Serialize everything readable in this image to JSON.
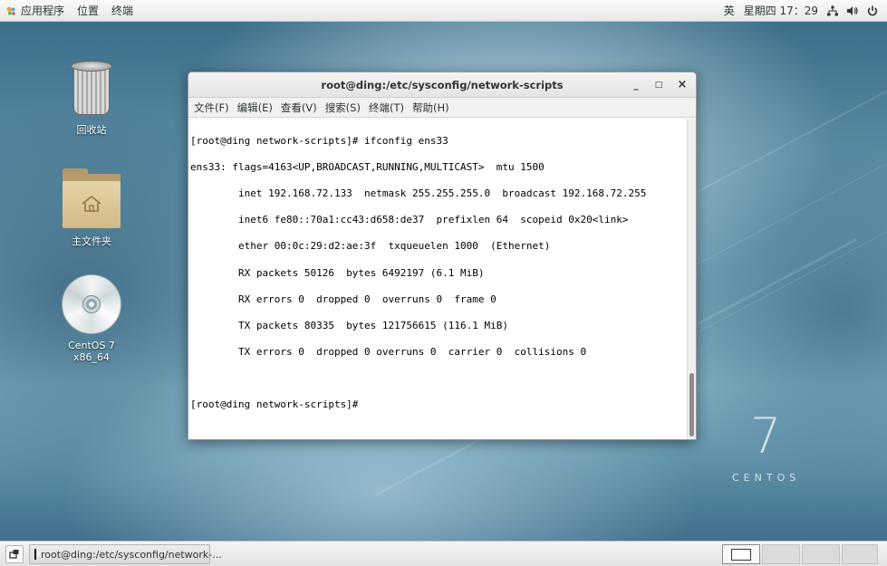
{
  "topbar": {
    "menus": [
      "应用程序",
      "位置",
      "终端"
    ],
    "input_method": "英",
    "clock": "星期四 17：29"
  },
  "desktop": {
    "icons": [
      {
        "label": "回收站",
        "icon": "trash-icon"
      },
      {
        "label": "主文件夹",
        "icon": "home-folder-icon"
      },
      {
        "label": "CentOS 7 x86_64",
        "icon": "disc-icon"
      }
    ],
    "watermark": {
      "number": "7",
      "word": "CENTOS"
    }
  },
  "terminal": {
    "title": "root@ding:/etc/sysconfig/network-scripts",
    "controls": {
      "minimize": "_",
      "maximize": "□",
      "close": "×"
    },
    "menu": [
      "文件(F)",
      "编辑(E)",
      "查看(V)",
      "搜索(S)",
      "终端(T)",
      "帮助(H)"
    ],
    "lines": [
      "[root@ding network-scripts]# ifconfig ens33",
      "ens33: flags=4163<UP,BROADCAST,RUNNING,MULTICAST>  mtu 1500",
      "        inet 192.168.72.133  netmask 255.255.255.0  broadcast 192.168.72.255",
      "        inet6 fe80::70a1:cc43:d658:de37  prefixlen 64  scopeid 0x20<link>",
      "        ether 00:0c:29:d2:ae:3f  txqueuelen 1000  (Ethernet)",
      "        RX packets 50126  bytes 6492197 (6.1 MiB)",
      "        RX errors 0  dropped 0  overruns 0  frame 0",
      "        TX packets 80335  bytes 121756615 (116.1 MiB)",
      "        TX errors 0  dropped 0 overruns 0  carrier 0  collisions 0",
      "",
      "[root@ding network-scripts]# "
    ]
  },
  "taskbar": {
    "task_label": "root@ding:/etc/sysconfig/network-..."
  }
}
